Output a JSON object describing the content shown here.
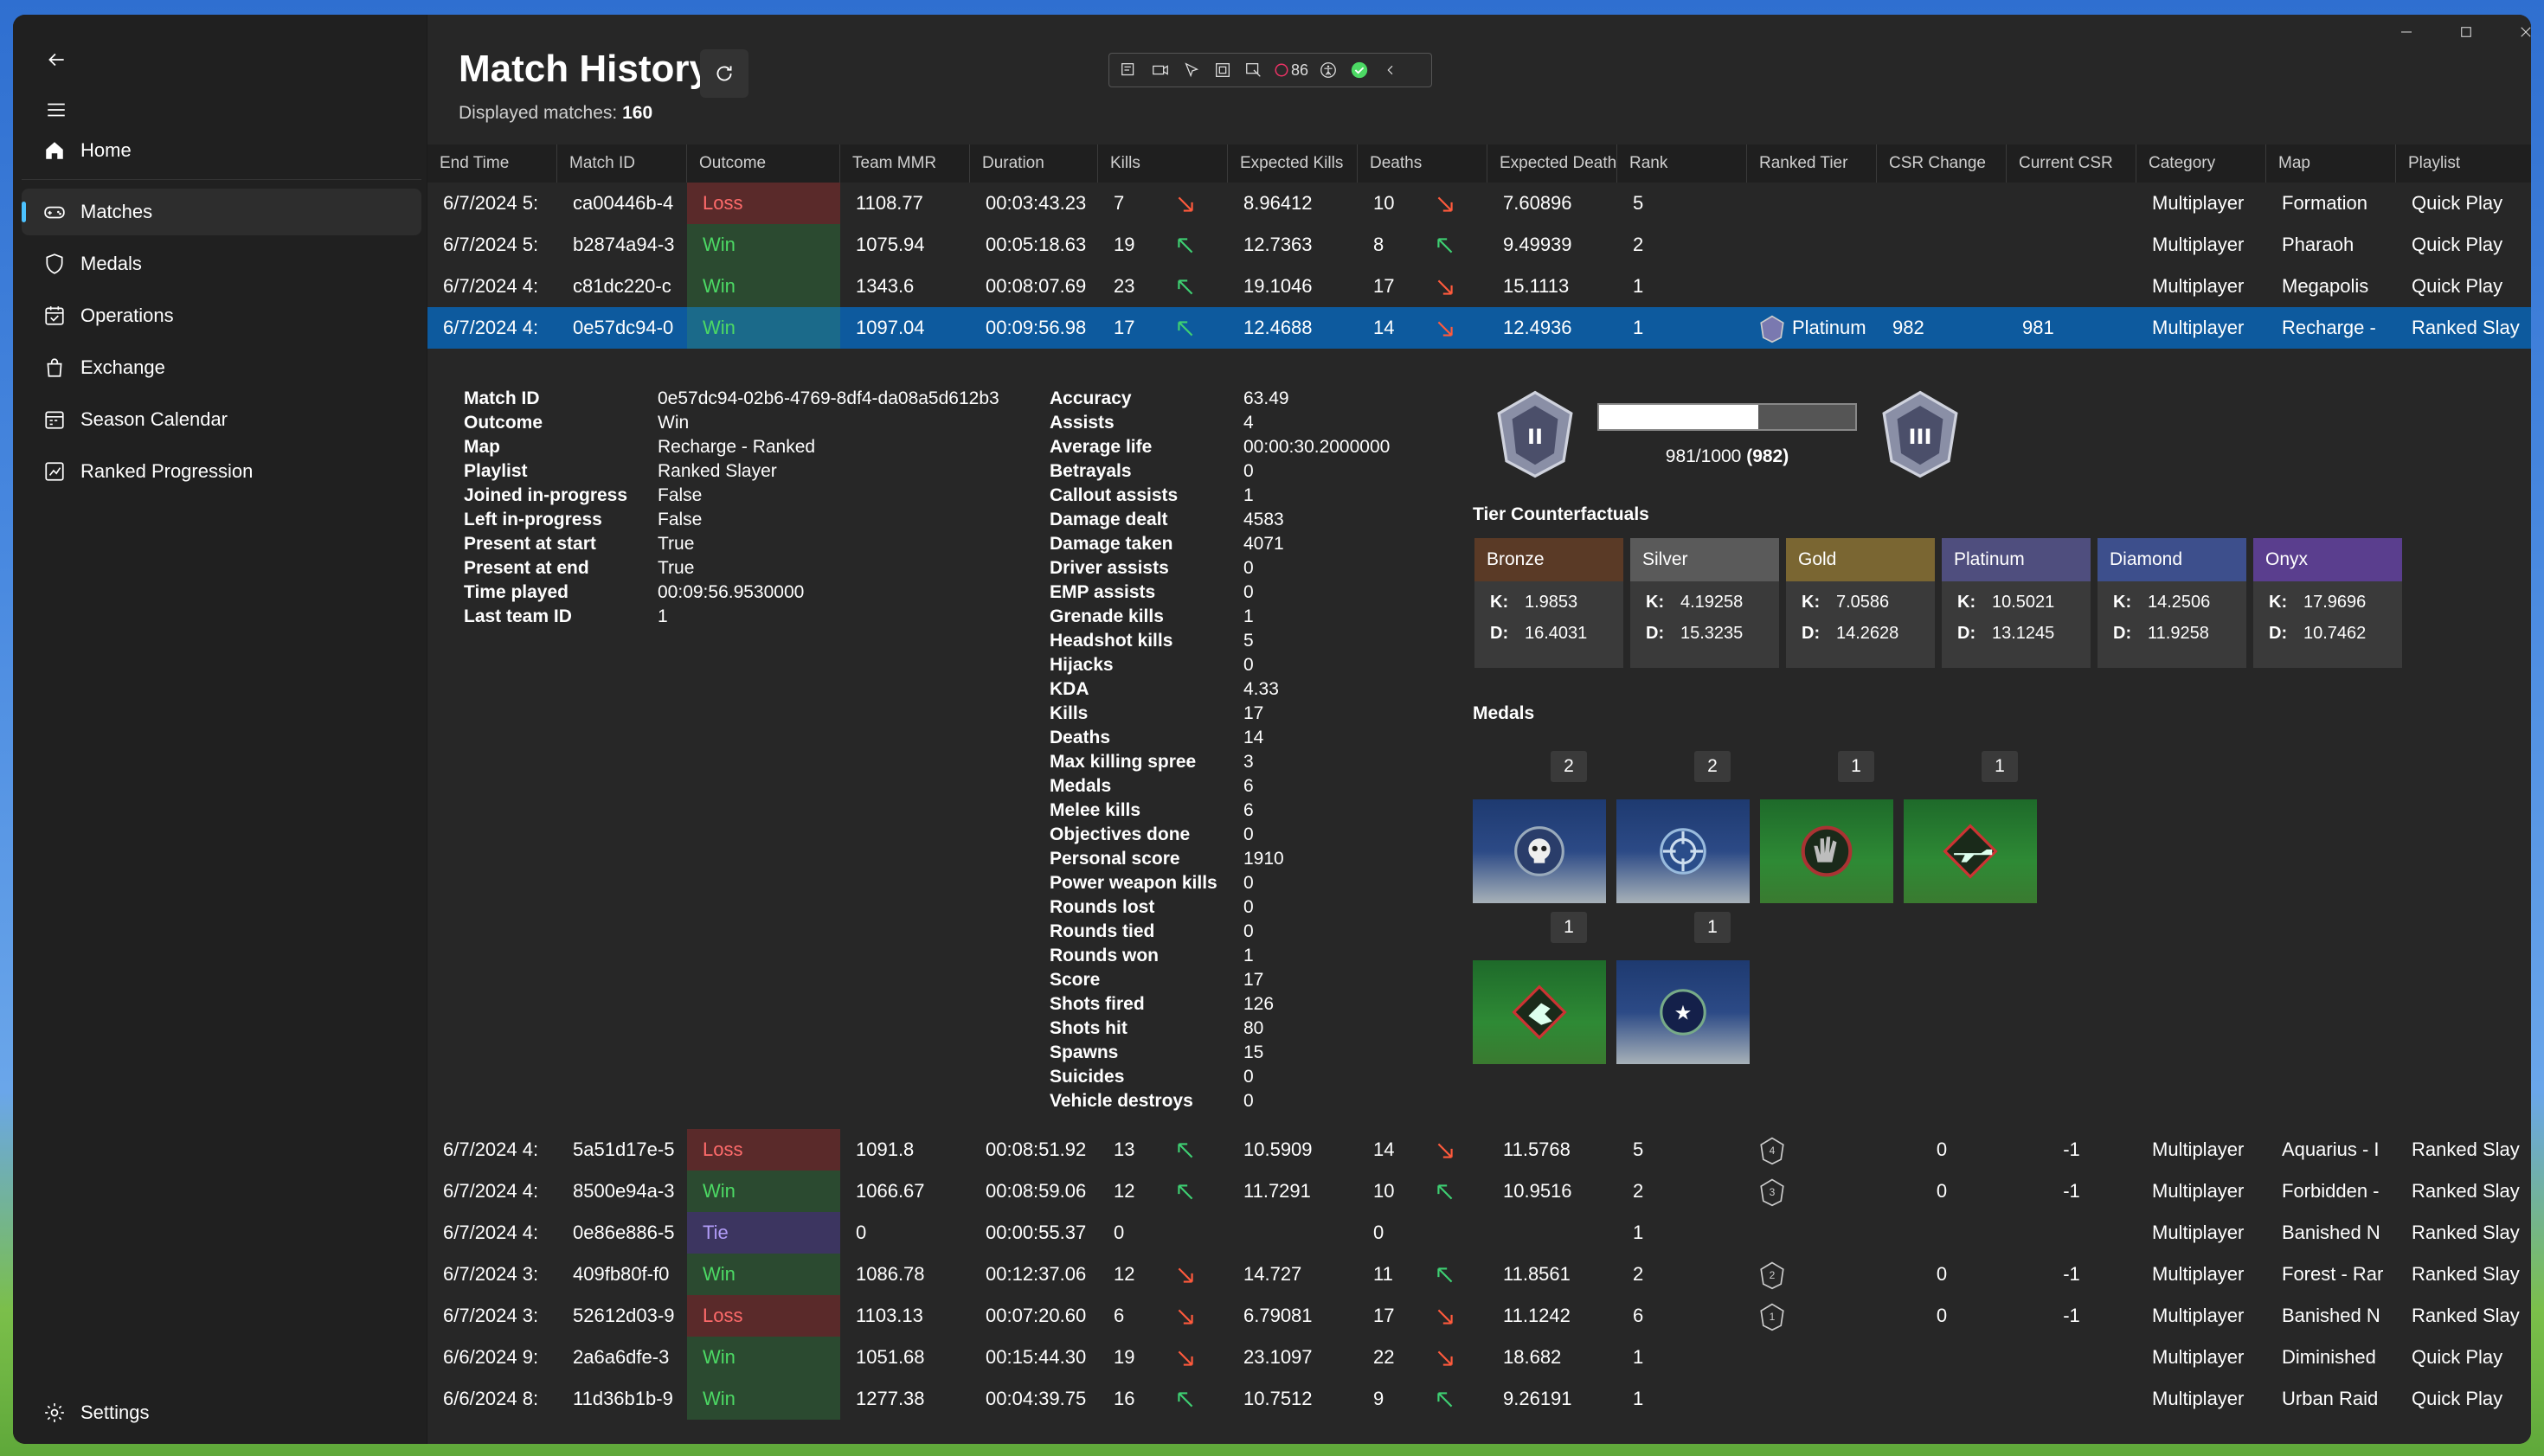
{
  "nav": {
    "back_icon": "back-arrow-icon",
    "menu_icon": "hamburger-icon",
    "items": [
      {
        "label": "Home",
        "icon": "home-icon"
      },
      {
        "label": "Matches",
        "icon": "gamepad-icon"
      },
      {
        "label": "Medals",
        "icon": "shield-icon"
      },
      {
        "label": "Operations",
        "icon": "operations-icon"
      },
      {
        "label": "Exchange",
        "icon": "bag-icon"
      },
      {
        "label": "Season Calendar",
        "icon": "calendar-icon"
      },
      {
        "label": "Ranked Progression",
        "icon": "chart-icon"
      }
    ],
    "settings": "Settings"
  },
  "header": {
    "title": "Match History",
    "displayed_label": "Displayed matches:",
    "displayed_count": "160",
    "toolbar_count": "86"
  },
  "columns": [
    "End Time",
    "Match ID",
    "Outcome",
    "Team MMR",
    "Duration",
    "Kills",
    "Expected Kills",
    "Deaths",
    "Expected Deaths",
    "Rank",
    "Ranked Tier",
    "CSR Change",
    "Current CSR",
    "Category",
    "Map",
    "Playlist"
  ],
  "rows_top": [
    {
      "end": "6/7/2024 5:",
      "id": "ca00446b-4",
      "outcome": "Loss",
      "mmr": "1108.77",
      "dur": "00:03:43.23",
      "kills": "7",
      "k_up": false,
      "exp_k": "8.96412",
      "deaths": "10",
      "d_up": false,
      "exp_d": "7.60896",
      "rank": "5",
      "tier": "",
      "csr_change": "",
      "cur_csr": "",
      "cat": "Multiplayer",
      "map": "Formation",
      "playlist": "Quick Play"
    },
    {
      "end": "6/7/2024 5:",
      "id": "b2874a94-3",
      "outcome": "Win",
      "mmr": "1075.94",
      "dur": "00:05:18.63",
      "kills": "19",
      "k_up": true,
      "exp_k": "12.7363",
      "deaths": "8",
      "d_up": true,
      "exp_d": "9.49939",
      "rank": "2",
      "tier": "",
      "csr_change": "",
      "cur_csr": "",
      "cat": "Multiplayer",
      "map": "Pharaoh",
      "playlist": "Quick Play"
    },
    {
      "end": "6/7/2024 4:",
      "id": "c81dc220-c",
      "outcome": "Win",
      "mmr": "1343.6",
      "dur": "00:08:07.69",
      "kills": "23",
      "k_up": true,
      "exp_k": "19.1046",
      "deaths": "17",
      "d_up": false,
      "exp_d": "15.1113",
      "rank": "1",
      "tier": "",
      "csr_change": "",
      "cur_csr": "",
      "cat": "Multiplayer",
      "map": "Megapolis",
      "playlist": "Quick Play"
    },
    {
      "end": "6/7/2024 4:",
      "id": "0e57dc94-0",
      "outcome": "Win",
      "mmr": "1097.04",
      "dur": "00:09:56.98",
      "kills": "17",
      "k_up": true,
      "exp_k": "12.4688",
      "deaths": "14",
      "d_up": false,
      "exp_d": "12.4936",
      "rank": "1",
      "tier": "Platinum",
      "csr_change": "982",
      "cur_csr": "981",
      "cat": "Multiplayer",
      "map": "Recharge -",
      "playlist": "Ranked Slay"
    }
  ],
  "details": {
    "left": [
      {
        "k": "Match ID",
        "v": "0e57dc94-02b6-4769-8df4-da08a5d612b3"
      },
      {
        "k": "Outcome",
        "v": "Win"
      },
      {
        "k": "Map",
        "v": "Recharge - Ranked"
      },
      {
        "k": "Playlist",
        "v": "Ranked Slayer"
      },
      {
        "k": "Joined in-progress",
        "v": "False"
      },
      {
        "k": "Left in-progress",
        "v": "False"
      },
      {
        "k": "Present at start",
        "v": "True"
      },
      {
        "k": "Present at end",
        "v": "True"
      },
      {
        "k": "Time played",
        "v": "00:09:56.9530000"
      },
      {
        "k": "Last team ID",
        "v": "1"
      }
    ],
    "stats": [
      {
        "k": "Accuracy",
        "v": "63.49"
      },
      {
        "k": "Assists",
        "v": "4"
      },
      {
        "k": "Average life",
        "v": "00:00:30.2000000"
      },
      {
        "k": "Betrayals",
        "v": "0"
      },
      {
        "k": "Callout assists",
        "v": "1"
      },
      {
        "k": "Damage dealt",
        "v": "4583"
      },
      {
        "k": "Damage taken",
        "v": "4071"
      },
      {
        "k": "Driver assists",
        "v": "0"
      },
      {
        "k": "EMP assists",
        "v": "0"
      },
      {
        "k": "Grenade kills",
        "v": "1"
      },
      {
        "k": "Headshot kills",
        "v": "5"
      },
      {
        "k": "Hijacks",
        "v": "0"
      },
      {
        "k": "KDA",
        "v": "4.33"
      },
      {
        "k": "Kills",
        "v": "17"
      },
      {
        "k": "Deaths",
        "v": "14"
      },
      {
        "k": "Max killing spree",
        "v": "3"
      },
      {
        "k": "Medals",
        "v": "6"
      },
      {
        "k": "Melee kills",
        "v": "6"
      },
      {
        "k": "Objectives done",
        "v": "0"
      },
      {
        "k": "Personal score",
        "v": "1910"
      },
      {
        "k": "Power weapon kills",
        "v": "0"
      },
      {
        "k": "Rounds lost",
        "v": "0"
      },
      {
        "k": "Rounds tied",
        "v": "0"
      },
      {
        "k": "Rounds won",
        "v": "1"
      },
      {
        "k": "Score",
        "v": "17"
      },
      {
        "k": "Shots fired",
        "v": "126"
      },
      {
        "k": "Shots hit",
        "v": "80"
      },
      {
        "k": "Spawns",
        "v": "15"
      },
      {
        "k": "Suicides",
        "v": "0"
      },
      {
        "k": "Vehicle destroys",
        "v": "0"
      }
    ],
    "progress": {
      "text": "981/1000",
      "csr": "(982)",
      "fraction": 0.62,
      "from_tier": "II",
      "to_tier": "III"
    },
    "tier_title": "Tier Counterfactuals",
    "tiers": [
      {
        "name": "Bronze",
        "color": "#5a3a26",
        "k": "1.9853",
        "d": "16.4031"
      },
      {
        "name": "Silver",
        "color": "#5a5a5a",
        "k": "4.19258",
        "d": "15.3235"
      },
      {
        "name": "Gold",
        "color": "#7a6632",
        "k": "7.0586",
        "d": "14.2628"
      },
      {
        "name": "Platinum",
        "color": "#4f4e7e",
        "k": "10.5021",
        "d": "13.1245"
      },
      {
        "name": "Diamond",
        "color": "#3d4f8c",
        "k": "14.2506",
        "d": "11.9258"
      },
      {
        "name": "Onyx",
        "color": "#5a3e8e",
        "k": "17.9696",
        "d": "10.7462"
      }
    ],
    "k_label": "K:",
    "d_label": "D:",
    "medals_title": "Medals",
    "medals": [
      {
        "count": "2",
        "icon": "skull-medal-icon",
        "bg": "blue"
      },
      {
        "count": "2",
        "icon": "crosshair-medal-icon",
        "bg": "blue"
      },
      {
        "count": "1",
        "icon": "hand-medal-icon",
        "bg": "green"
      },
      {
        "count": "1",
        "icon": "rifle-medal-icon",
        "bg": "green"
      },
      {
        "count": "1",
        "icon": "fist-medal-icon",
        "bg": "green"
      },
      {
        "count": "1",
        "icon": "star-medal-icon",
        "bg": "blue"
      }
    ]
  },
  "rows_bottom": [
    {
      "end": "6/7/2024 4:",
      "id": "5a51d17e-5",
      "outcome": "Loss",
      "mmr": "1091.8",
      "dur": "00:08:51.92",
      "kills": "13",
      "k_up": true,
      "exp_k": "10.5909",
      "deaths": "14",
      "d_up": false,
      "exp_d": "11.5768",
      "rank": "5",
      "badge": "4",
      "csr_change": "0",
      "cur_csr": "-1",
      "cat": "Multiplayer",
      "map": "Aquarius - I",
      "playlist": "Ranked Slay"
    },
    {
      "end": "6/7/2024 4:",
      "id": "8500e94a-3",
      "outcome": "Win",
      "mmr": "1066.67",
      "dur": "00:08:59.06",
      "kills": "12",
      "k_up": true,
      "exp_k": "11.7291",
      "deaths": "10",
      "d_up": true,
      "exp_d": "10.9516",
      "rank": "2",
      "badge": "3",
      "csr_change": "0",
      "cur_csr": "-1",
      "cat": "Multiplayer",
      "map": "Forbidden -",
      "playlist": "Ranked Slay"
    },
    {
      "end": "6/7/2024 4:",
      "id": "0e86e886-5",
      "outcome": "Tie",
      "mmr": "0",
      "dur": "00:00:55.37",
      "kills": "0",
      "k_up": null,
      "exp_k": "",
      "deaths": "0",
      "d_up": null,
      "exp_d": "",
      "rank": "1",
      "badge": "",
      "csr_change": "",
      "cur_csr": "",
      "cat": "Multiplayer",
      "map": "Banished N",
      "playlist": "Ranked Slay"
    },
    {
      "end": "6/7/2024 3:",
      "id": "409fb80f-f0",
      "outcome": "Win",
      "mmr": "1086.78",
      "dur": "00:12:37.06",
      "kills": "12",
      "k_up": false,
      "exp_k": "14.727",
      "deaths": "11",
      "d_up": true,
      "exp_d": "11.8561",
      "rank": "2",
      "badge": "2",
      "csr_change": "0",
      "cur_csr": "-1",
      "cat": "Multiplayer",
      "map": "Forest - Rar",
      "playlist": "Ranked Slay"
    },
    {
      "end": "6/7/2024 3:",
      "id": "52612d03-9",
      "outcome": "Loss",
      "mmr": "1103.13",
      "dur": "00:07:20.60",
      "kills": "6",
      "k_up": false,
      "exp_k": "6.79081",
      "deaths": "17",
      "d_up": false,
      "exp_d": "11.1242",
      "rank": "6",
      "badge": "1",
      "csr_change": "0",
      "cur_csr": "-1",
      "cat": "Multiplayer",
      "map": "Banished N",
      "playlist": "Ranked Slay"
    },
    {
      "end": "6/6/2024 9:",
      "id": "2a6a6dfe-3",
      "outcome": "Win",
      "mmr": "1051.68",
      "dur": "00:15:44.30",
      "kills": "19",
      "k_up": false,
      "exp_k": "23.1097",
      "deaths": "22",
      "d_up": false,
      "exp_d": "18.682",
      "rank": "1",
      "badge": "",
      "csr_change": "",
      "cur_csr": "",
      "cat": "Multiplayer",
      "map": "Diminished",
      "playlist": "Quick Play"
    },
    {
      "end": "6/6/2024 8:",
      "id": "11d36b1b-9",
      "outcome": "Win",
      "mmr": "1277.38",
      "dur": "00:04:39.75",
      "kills": "16",
      "k_up": true,
      "exp_k": "10.7512",
      "deaths": "9",
      "d_up": true,
      "exp_d": "9.26191",
      "rank": "1",
      "badge": "",
      "csr_change": "",
      "cur_csr": "",
      "cat": "Multiplayer",
      "map": "Urban Raid",
      "playlist": "Quick Play"
    }
  ]
}
